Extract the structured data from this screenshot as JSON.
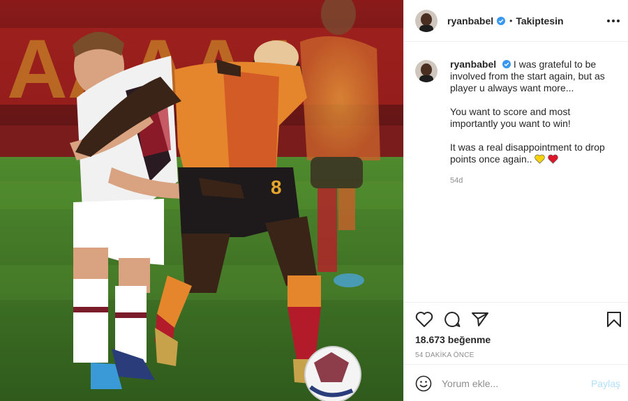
{
  "post": {
    "username": "ryanbabel",
    "separator": "•",
    "follow_status": "Takiptesin",
    "caption": {
      "p1": "I was grateful to be involved from the start again, but as player u always want more...",
      "p2": "You want to score and most importantly you want to win!",
      "p3": "It was a real disappointment to drop points once again..",
      "emoji": [
        "yellow-heart",
        "red-heart"
      ],
      "time": "54d"
    },
    "likes": "18.673 beğenme",
    "time_ago": "54 DAKİKA ÖNCE",
    "comment": {
      "placeholder": "Yorum ekle...",
      "post_label": "Paylaş"
    }
  },
  "colors": {
    "verified": "#3897f0",
    "post_button_disabled": "#b2dffc",
    "text": "#262626",
    "muted": "#8e8e8e",
    "yellow_heart": "#f5d20a",
    "red_heart": "#e0172a"
  },
  "icons": [
    "more-icon",
    "heart-icon",
    "comment-icon",
    "share-icon",
    "bookmark-icon",
    "smiley-icon",
    "verified-icon"
  ]
}
